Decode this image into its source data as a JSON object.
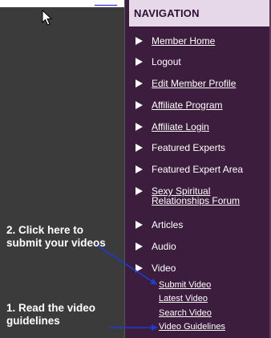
{
  "top_link": "____",
  "top_tail": "y",
  "navigation": {
    "heading": "NAVIGATION",
    "items": [
      {
        "label": "Member Home",
        "link": true
      },
      {
        "label": "Logout",
        "link": false
      },
      {
        "label": "Edit Member Profile",
        "link": true
      },
      {
        "label": "Affiliate Program",
        "link": true
      },
      {
        "label": "Affiliate Login",
        "link": true
      },
      {
        "label": "Featured Experts",
        "link": false
      },
      {
        "label": "Featured Expert Area",
        "link": false
      },
      {
        "label": "Sexy Spiritual Relationships Forum",
        "link": true
      },
      {
        "label": "Articles",
        "link": false
      },
      {
        "label": "Audio",
        "link": false
      },
      {
        "label": "Video",
        "link": false
      }
    ],
    "video_submenu": [
      "Submit Video",
      "Latest Video",
      "Search Video",
      "Video Guidelines"
    ]
  },
  "callouts": {
    "submit": "2. Click here to submit your videos",
    "guidelines": "1. Read the video guidelines"
  },
  "colors": {
    "nav_bg": "#3d1d3d",
    "nav_header_bg": "#e6d8e8",
    "left_panel_bg": "#3b3b3b",
    "arrow": "#1e3cd2"
  },
  "icons": {
    "cursor": "mouse-pointer-icon",
    "bullet": "triangle-right-icon"
  }
}
